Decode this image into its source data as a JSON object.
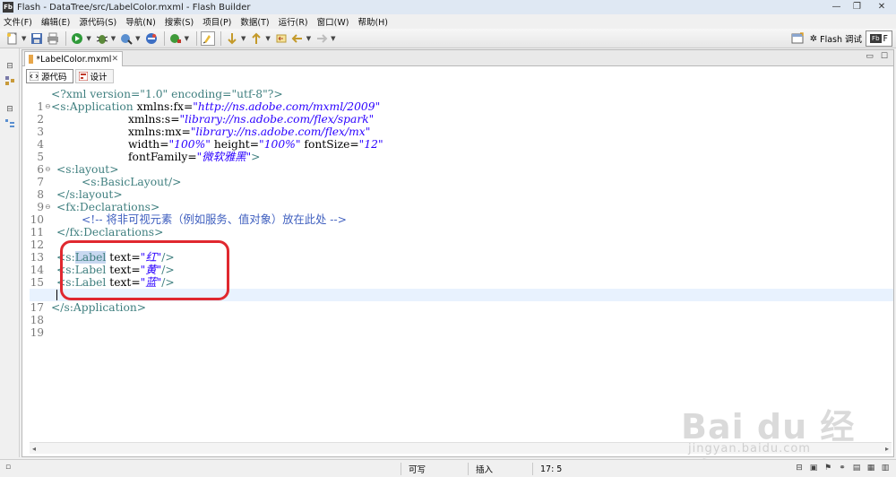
{
  "window": {
    "app_badge": "Fb",
    "title": "Flash  - DataTree/src/LabelColor.mxml - Flash Builder",
    "minimize": "—",
    "maximize": "❐",
    "close": "✕"
  },
  "menu": [
    "文件(F)",
    "编辑(E)",
    "源代码(S)",
    "导航(N)",
    "搜索(S)",
    "项目(P)",
    "数据(T)",
    "运行(R)",
    "窗口(W)",
    "帮助(H)"
  ],
  "toolbar": {
    "perspective_label": "Flash 调试",
    "perspective_active_label": "F"
  },
  "editor": {
    "tab_label": "*LabelColor.mxml",
    "tab_close": "✕",
    "source_mode_label": "源代码",
    "design_mode_label": "设计",
    "current_line": 17,
    "highlighted_token": "Label",
    "lines": [
      {
        "n": "1"
      },
      {
        "n": "2"
      },
      {
        "n": "3"
      },
      {
        "n": "4"
      },
      {
        "n": "5"
      },
      {
        "n": "6"
      },
      {
        "n": "7"
      },
      {
        "n": "8"
      },
      {
        "n": "9"
      },
      {
        "n": "10"
      },
      {
        "n": "11"
      },
      {
        "n": "12"
      },
      {
        "n": "13"
      },
      {
        "n": "14"
      },
      {
        "n": "15"
      },
      {
        "n": "16"
      },
      {
        "n": "17"
      },
      {
        "n": "18"
      },
      {
        "n": "19"
      }
    ],
    "code": {
      "l1_decl": "<?xml version=\"1.0\" encoding=\"utf-8\"?>",
      "l2_tag": "<s:Application",
      "l2_attr": " xmlns:fx=",
      "l2_val": "\"http://ns.adobe.com/mxml/2009\"",
      "l3_attr": "xmlns:s=",
      "l3_val": "\"library://ns.adobe.com/flex/spark\"",
      "l4_attr": "xmlns:mx=",
      "l4_val": "\"library://ns.adobe.com/flex/mx\"",
      "l5_attr1": "width=",
      "l5_val1": "\"100%\"",
      "l5_attr2": " height=",
      "l5_val2": "\"100%\"",
      "l5_attr3": " fontSize=",
      "l5_val3": "\"12\"",
      "l6_attr": "fontFamily=",
      "l6_val": "\"微软雅黑\"",
      "l6_end": ">",
      "l7_tag": "<s:layout>",
      "l8_tag": "<s:BasicLayout/>",
      "l9_tag": "</s:layout>",
      "l10_tag": "<fx:Declarations>",
      "l11_comment": "<!-- 将非可视元素（例如服务、值对象）放在此处 -->",
      "l12_tag": "</fx:Declarations>",
      "l14_open": "<s:",
      "l14_hl": "Label",
      "l14_attr": " text=",
      "l14_val": "\"红\"",
      "l14_close": "/>",
      "l15_tag": "<s:Label",
      "l15_attr": " text=",
      "l15_val": "\"黄\"",
      "l15_close": "/>",
      "l16_tag": "<s:Label",
      "l16_attr": " text=",
      "l16_val": "\"蓝\"",
      "l16_close": "/>",
      "l18_tag": "</s:Application>"
    }
  },
  "status": {
    "writable": "可写",
    "insert_mode": "插入",
    "cursor_pos": "17: 5"
  },
  "watermark": {
    "brand": "Bai du 经验",
    "url": "jingyan.baidu.com"
  },
  "colors": {
    "tag": "#3f7f7f",
    "string": "#2a00ff",
    "comment": "#3f5fbf",
    "annotation_circle": "#e0282f",
    "current_line_bg": "#e8f2fe"
  }
}
